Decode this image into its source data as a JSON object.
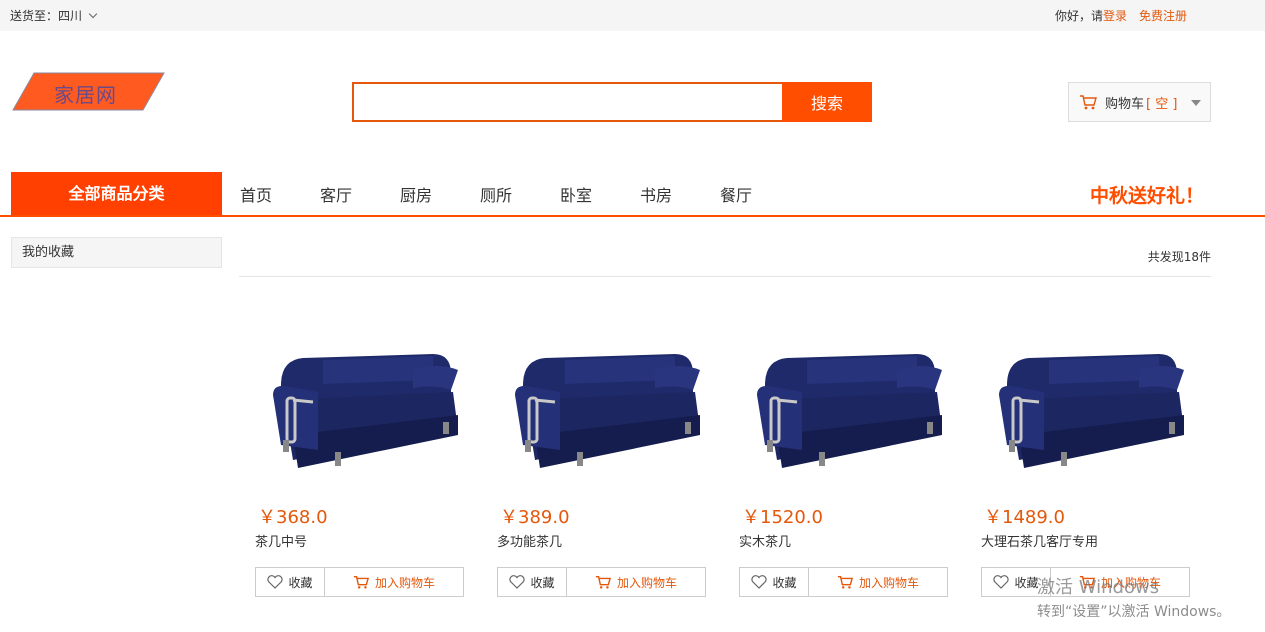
{
  "topbar": {
    "ship_to_label": "送货至：",
    "ship_to_region": "四川",
    "greeting": "你好，请",
    "login": "登录",
    "register": "免费注册"
  },
  "logo": {
    "text": "家居网"
  },
  "search": {
    "value": "",
    "button": "搜索"
  },
  "cart": {
    "label": "购物车",
    "bracket_open": "[",
    "status": "空",
    "bracket_close": "]"
  },
  "nav": {
    "all_categories": "全部商品分类",
    "links": [
      "首页",
      "客厅",
      "厨房",
      "厕所",
      "卧室",
      "书房",
      "餐厅"
    ],
    "promo": "中秋送好礼！"
  },
  "sidebar": {
    "favorites": "我的收藏"
  },
  "results": {
    "count_text": "共发现18件"
  },
  "products": [
    {
      "price": "￥368.0",
      "name": "茶几中号",
      "collect": "收藏",
      "add": "加入购物车"
    },
    {
      "price": "￥389.0",
      "name": "多功能茶几",
      "collect": "收藏",
      "add": "加入购物车"
    },
    {
      "price": "￥1520.0",
      "name": "实木茶几",
      "collect": "收藏",
      "add": "加入购物车"
    },
    {
      "price": "￥1489.0",
      "name": "大理石茶几客厅专用",
      "collect": "收藏",
      "add": "加入购物车"
    }
  ],
  "watermark": {
    "line1": "激活 Windows",
    "line2": "转到“设置”以激活 Windows。"
  },
  "colors": {
    "accent": "#ff4e00",
    "price": "#e4580c",
    "sofa": "#1f2a6b"
  },
  "icons": {
    "heart": "heart-icon",
    "cart": "cart-icon",
    "chevron": "chevron-down-icon"
  }
}
